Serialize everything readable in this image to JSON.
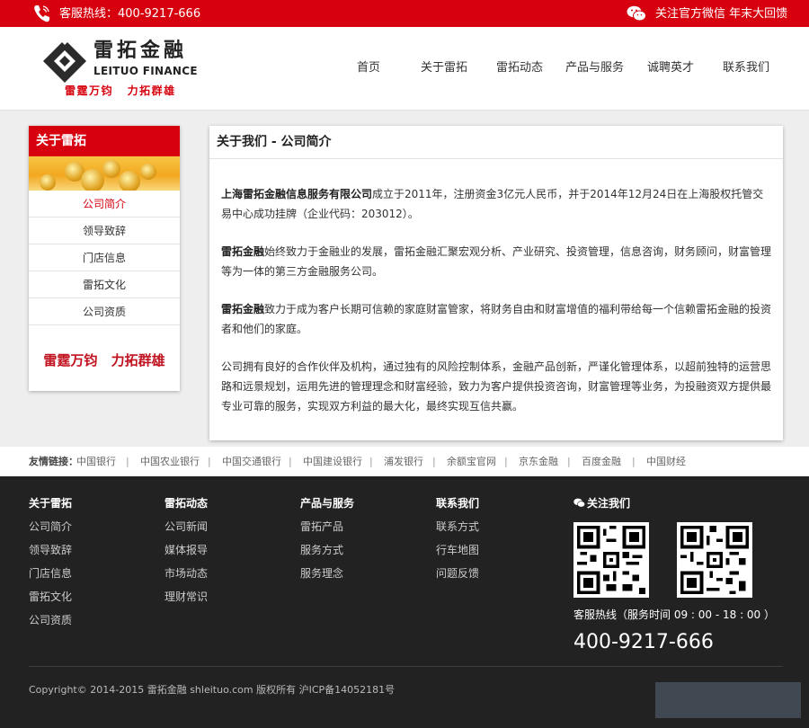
{
  "topbar": {
    "hotline": "客服热线：400-9217-666",
    "wechat": "关注官方微信 年末大回馈",
    "bg_color": "#d7000f"
  },
  "header": {
    "logo_cn": "雷拓金融",
    "logo_en": "LEITUO FINANCE",
    "slogan": "雷霆万钧 力拓群雄"
  },
  "nav": [
    {
      "label": "首页"
    },
    {
      "label": "关于雷拓"
    },
    {
      "label": "雷拓动态"
    },
    {
      "label": "产品与服务"
    },
    {
      "label": "诚聘英才"
    },
    {
      "label": "联系我们"
    }
  ],
  "sidebar": {
    "title": "关于雷拓",
    "items": [
      {
        "label": "公司简介",
        "active": true
      },
      {
        "label": "领导致辞"
      },
      {
        "label": "门店信息"
      },
      {
        "label": "雷拓文化"
      },
      {
        "label": "公司资质"
      }
    ],
    "slogan": "雷霆万钧 力拓群雄"
  },
  "content": {
    "title": "关于我们 - 公司简介",
    "paragraphs": [
      {
        "bold": "上海雷拓金融信息服务有限公司",
        "text": "成立于2011年，注册资金3亿元人民币，并于2014年12月24日在上海股权托管交易中心成功挂牌（企业代码：203012）。"
      },
      {
        "bold": "雷拓金融",
        "text": "始终致力于金融业的发展，雷拓金融汇聚宏观分析、产业研究、投资管理，信息咨询，财务顾问，财富管理等为一体的第三方金融服务公司。"
      },
      {
        "bold": "雷拓金融",
        "text": "致力于成为客户长期可信赖的家庭财富管家，将财务自由和财富增值的福利带给每一个信赖雷拓金融的投资者和他们的家庭。"
      },
      {
        "bold": "",
        "text": "公司拥有良好的合作伙伴及机构，通过独有的风险控制体系，金融产品创新，严谨化管理体系，以超前独特的运营思路和远景规划，运用先进的管理理念和财富经验，致力为客户提供投资咨询，财富管理等业务，为投融资双方提供最专业可靠的服务，实现双方利益的最大化，最终实现互信共赢。"
      }
    ]
  },
  "links": {
    "label": "友情链接：",
    "items": [
      "中国银行",
      "中国农业银行",
      "中国交通银行",
      "中国建设银行",
      "浦发银行",
      "余额宝官网",
      "京东金融",
      "百度金融",
      "中国财经"
    ],
    "separator": "|"
  },
  "footer": {
    "columns": [
      {
        "title": "关于雷拓",
        "items": [
          "公司简介",
          "领导致辞",
          "门店信息",
          "雷拓文化",
          "公司资质"
        ]
      },
      {
        "title": "雷拓动态",
        "items": [
          "公司新闻",
          "媒体报导",
          "市场动态",
          "理财常识"
        ]
      },
      {
        "title": "产品与服务",
        "items": [
          "雷拓产品",
          "服务方式",
          "服务理念"
        ]
      },
      {
        "title": "联系我们",
        "items": [
          "联系方式",
          "行车地图",
          "问题反馈"
        ]
      }
    ],
    "follow_title": "关注我们",
    "service": "客服热线（服务时间 09 : 00 - 18 : 00 ）",
    "phone": "400-9217-666",
    "copyright": "Copyright© 2014-2015 雷拓金融 shleituo.com 版权所有   沪ICP备14052181号",
    "bg_color": "#222222"
  }
}
